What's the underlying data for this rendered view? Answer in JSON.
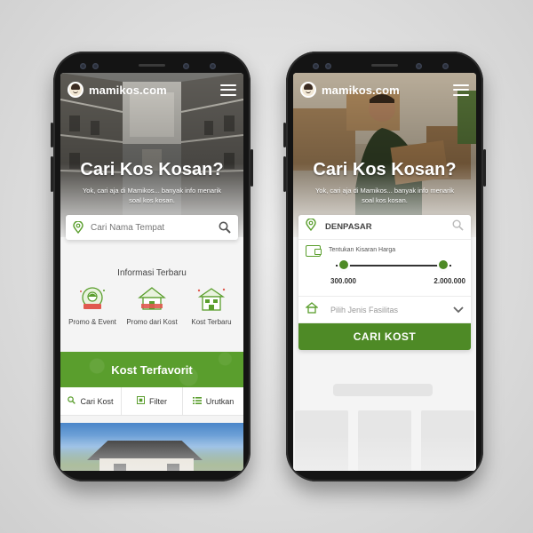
{
  "left_phone": {
    "brand": "mamikos.com",
    "hero": {
      "title": "Cari Kos Kosan?",
      "subtitle": "Yok, cari aja di Mamikos... banyak info menarik soal kos kosan."
    },
    "search": {
      "placeholder": "Cari Nama Tempat"
    },
    "info_section": {
      "title": "Informasi Terbaru",
      "categories": [
        {
          "label": "Promo & Event",
          "icon": "promo-event-icon"
        },
        {
          "label": "Promo dari Kost",
          "icon": "promo-house-icon"
        },
        {
          "label": "Kost Terbaru",
          "icon": "new-kost-icon"
        }
      ]
    },
    "favorite": {
      "title": "Kost Terfavorit",
      "tabs": [
        {
          "label": "Cari Kost",
          "icon": "search-icon"
        },
        {
          "label": "Filter",
          "icon": "filter-icon"
        },
        {
          "label": "Urutkan",
          "icon": "sort-icon"
        }
      ]
    }
  },
  "right_phone": {
    "brand": "mamikos.com",
    "hero": {
      "title": "Cari Kos Kosan?",
      "subtitle": "Yok, cari aja di Mamikos... banyak info menarik soal kos kosan."
    },
    "search": {
      "value": "DENPASAR"
    },
    "price": {
      "label": "Tentukan Kisaran Harga",
      "min": "300.000",
      "max": "2.000.000"
    },
    "facility": {
      "placeholder": "Pilih Jenis Fasilitas"
    },
    "cta": "CARI KOST"
  },
  "colors": {
    "brand_green": "#5a9e2d",
    "cta_green": "#4e8a26",
    "phone_body": "#141414"
  }
}
